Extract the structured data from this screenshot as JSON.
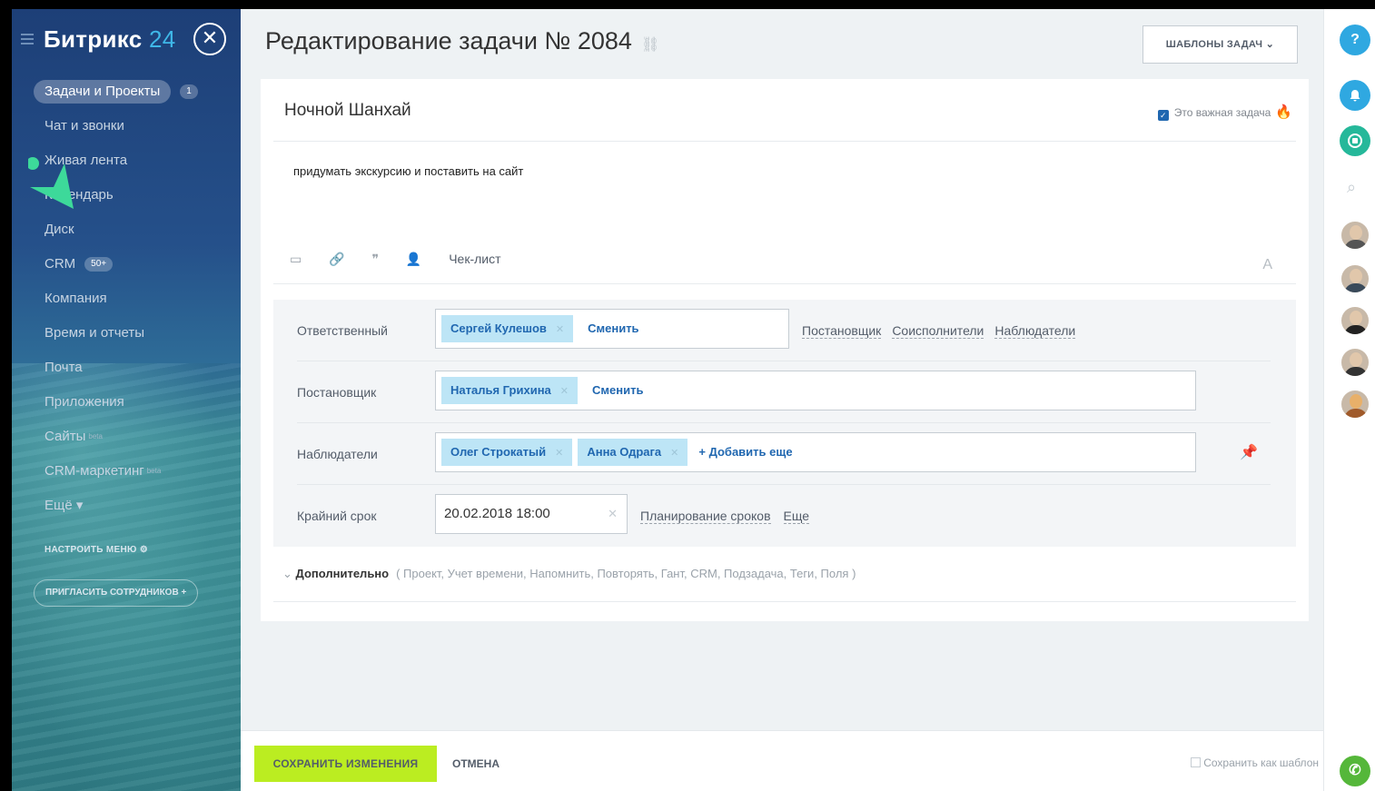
{
  "sidebar": {
    "logo_text": "Битрикс",
    "logo_num": "24",
    "items": [
      {
        "label": "Задачи и Проекты",
        "counter": "1"
      },
      {
        "label": "Чат и звонки"
      },
      {
        "label": "Живая лента"
      },
      {
        "label": "Календарь"
      },
      {
        "label": "Диск"
      },
      {
        "label": "CRM",
        "counter": "50+"
      },
      {
        "label": "Компания"
      },
      {
        "label": "Время и отчеты"
      },
      {
        "label": "Почта"
      },
      {
        "label": "Приложения"
      },
      {
        "label": "Сайты",
        "badge": "beta"
      },
      {
        "label": "CRM-маркетинг",
        "badge": "beta"
      },
      {
        "label": "Ещё ▾"
      }
    ],
    "settings_label": "НАСТРОИТЬ МЕНЮ",
    "invite_label": "ПРИГЛАСИТЬ СОТРУДНИКОВ"
  },
  "header": {
    "title": "Редактирование задачи № 2084",
    "templates_button": "ШАБЛОНЫ ЗАДАЧ"
  },
  "task": {
    "title": "Ночной Шанхай",
    "important_label": "Это важная задача",
    "important_checked": true,
    "description": "придумать экскурсию и поставить на сайт",
    "checklist_label": "Чек-лист"
  },
  "fields": {
    "responsible": {
      "label": "Ответственный",
      "person": "Сергей Кулешов",
      "change": "Сменить",
      "roles": [
        "Постановщик",
        "Соисполнители",
        "Наблюдатели"
      ]
    },
    "creator": {
      "label": "Постановщик",
      "person": "Наталья Грихина",
      "change": "Сменить"
    },
    "observers": {
      "label": "Наблюдатели",
      "people": [
        "Олег Строкатый",
        "Анна Одрага"
      ],
      "add": "+ Добавить еще"
    },
    "deadline": {
      "label": "Крайний срок",
      "value": "20.02.2018 18:00",
      "planning": "Планирование сроков",
      "more": "Еще"
    }
  },
  "extra": {
    "label": "Дополнительно",
    "items": "( Проект,  Учет времени,  Напомнить,  Повторять,  Гант,  CRM,  Подзадача,  Теги,  Поля )"
  },
  "footer": {
    "save": "СОХРАНИТЬ ИЗМЕНЕНИЯ",
    "cancel": "ОТМЕНА",
    "save_template": "Сохранить как шаблон"
  },
  "colors": {
    "accent_blue": "#2067b0",
    "save_green": "#bbed21",
    "chip_bg": "#bde5f6",
    "help_blue": "#2fa8e1",
    "notify_blue": "#2fa8e1",
    "chat_teal": "#25b89a",
    "phone_green": "#55b73a"
  },
  "rail": {
    "help_icon": "question-icon",
    "notify_icon": "bell-icon",
    "chat_icon": "chat-icon",
    "search_icon": "search-icon",
    "phone_icon": "phone-icon",
    "help_text": "?"
  }
}
